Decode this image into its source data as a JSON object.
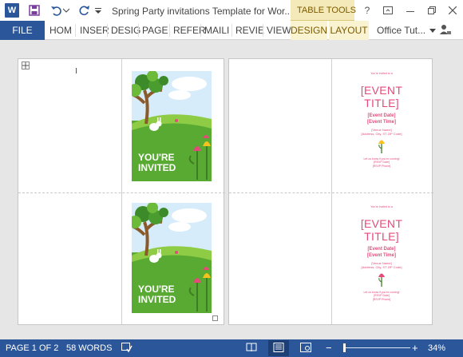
{
  "window": {
    "title": "Spring Party invitations Template for Wor...",
    "contextual_tab_group": "TABLE TOOLS",
    "help": "?",
    "app_logo": "W"
  },
  "ribbon": {
    "file": "FILE",
    "tabs": [
      "HOM",
      "INSER",
      "DESIG",
      "PAGE",
      "REFER",
      "MAILI",
      "REVIE",
      "VIEW"
    ],
    "context_tabs": [
      "DESIGN",
      "LAYOUT"
    ],
    "account": "Office Tut..."
  },
  "document": {
    "cover": {
      "line1": "YOU'RE",
      "line2": "INVITED"
    },
    "inside": {
      "greeting": "You're invited to a",
      "event_line1": "[EVENT",
      "event_line2": "TITLE]",
      "event_date": "[Event Date]",
      "event_time": "[Event Time]",
      "venue": "[Venue Name]",
      "address": "[Address, City, ST ZIP Code]",
      "rsvp_line": "Let us know if you're coming!",
      "rsvp_by": "[RSVP Date]",
      "rsvp_phone": "[RSVP Phone]"
    }
  },
  "status": {
    "page": "PAGE 1 OF 2",
    "words": "58 WORDS",
    "zoom": "34%",
    "zoom_level": 0.34
  },
  "colors": {
    "brand": "#2b579a",
    "invite_pink": "#e54a7b",
    "grass": "#5aa832",
    "context_tab": "#f4e9b8"
  }
}
